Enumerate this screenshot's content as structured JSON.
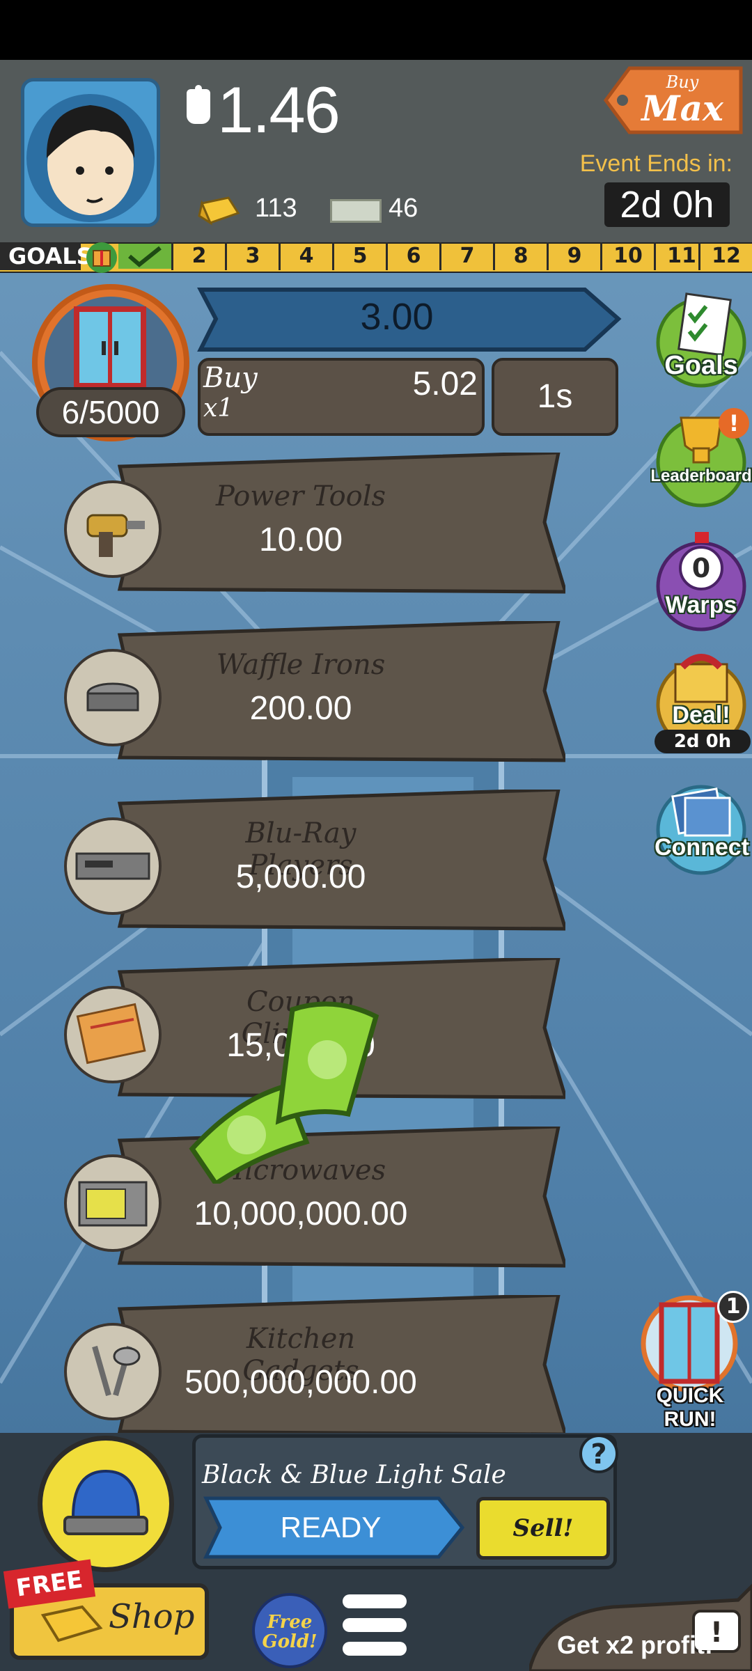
{
  "header": {
    "money": "1.46",
    "gold_count": "113",
    "ticket_count": "46",
    "buy_max": {
      "top": "Buy",
      "main": "Max"
    },
    "event_label": "Event Ends in:",
    "event_timer": "2d 0h"
  },
  "goals": {
    "label": "GOALS",
    "milestones": [
      "2",
      "3",
      "4",
      "5",
      "6",
      "7",
      "8",
      "9",
      "10",
      "11",
      "12"
    ]
  },
  "main_business": {
    "count": "6/5000",
    "progress_value": "3.00",
    "buy_label": "Buy",
    "buy_multiplier": "x1",
    "buy_cost": "5.02",
    "timer": "1s"
  },
  "businesses": [
    {
      "name": "Power Tools",
      "price": "10.00",
      "icon": "drill-icon"
    },
    {
      "name": "Waffle Irons",
      "price": "200.00",
      "icon": "waffle-iron-icon"
    },
    {
      "name": "Blu-Ray Players",
      "price": "5,000.00",
      "icon": "bluray-player-icon"
    },
    {
      "name": "Coupon Clippers",
      "price": "15,000.00",
      "icon": "coupon-icon"
    },
    {
      "name": "Microwaves",
      "price": "10,000,000.00",
      "icon": "microwave-icon"
    },
    {
      "name": "Kitchen Gadgets",
      "price": "500,000,000.00",
      "icon": "kitchen-gadgets-icon"
    }
  ],
  "side_menu": {
    "goals": "Goals",
    "leaderboard": "Leaderboard",
    "leaderboard_badge": "!",
    "warps": "Warps",
    "warps_count": "0",
    "deal": "Deal!",
    "deal_timer": "2d 0h",
    "connect": "Connect",
    "quick_run": "QUICK RUN!",
    "quick_run_badge": "1"
  },
  "bottom": {
    "sale_title": "Black & Blue Light Sale",
    "sale_help": "?",
    "ready": "READY",
    "sell": "Sell!",
    "free_tag": "FREE",
    "shop": "Shop",
    "free_gold": "Free Gold!",
    "x2_profit": "Get x2 profit!",
    "x2_badge": "!"
  },
  "colors": {
    "header_bg": "#545a5a",
    "goals_bar": "#f0c13a",
    "progress_blue": "#2c5f8c",
    "banner_brown": "#5b5147",
    "accent_orange": "#e1732c",
    "side_green": "#7cbf3c",
    "ready_blue": "#3c8fd6",
    "sell_yellow": "#eadc2e"
  }
}
